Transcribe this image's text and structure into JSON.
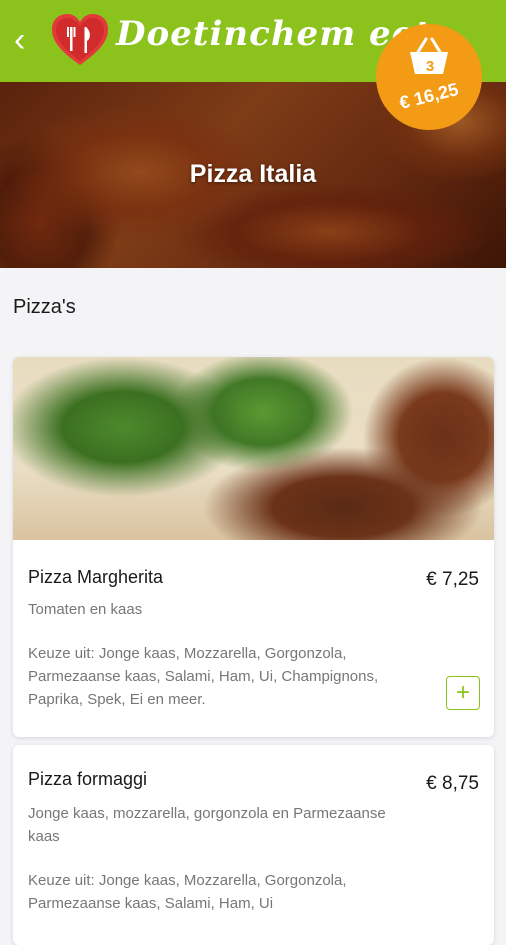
{
  "header": {
    "back_icon": "chevron-left-icon",
    "logo_icon": "heart-fork-knife-icon",
    "brand_text": "Doetinchem eet",
    "accent_color": "#8bc21c"
  },
  "cart": {
    "icon": "basket-icon",
    "count": "3",
    "total": "€ 16,25",
    "color": "#f49b16"
  },
  "restaurant": {
    "name": "Pizza Italia"
  },
  "section": {
    "title": "Pizza's"
  },
  "items": [
    {
      "name": "Pizza Margherita",
      "price": "€ 7,25",
      "description": "Tomaten en kaas",
      "options": "Keuze uit: Jonge kaas, Mozzarella, Gorgonzola, Parmezaanse kaas, Salami, Ham, Ui, Champignons, Paprika, Spek, Ei en meer.",
      "add_label": "+"
    },
    {
      "name": "Pizza formaggi",
      "price": "€ 8,75",
      "description": "Jonge kaas, mozzarella, gorgonzola en Parmezaanse kaas",
      "options": "Keuze uit: Jonge kaas, Mozzarella, Gorgonzola, Parmezaanse kaas, Salami, Ham, Ui"
    }
  ]
}
